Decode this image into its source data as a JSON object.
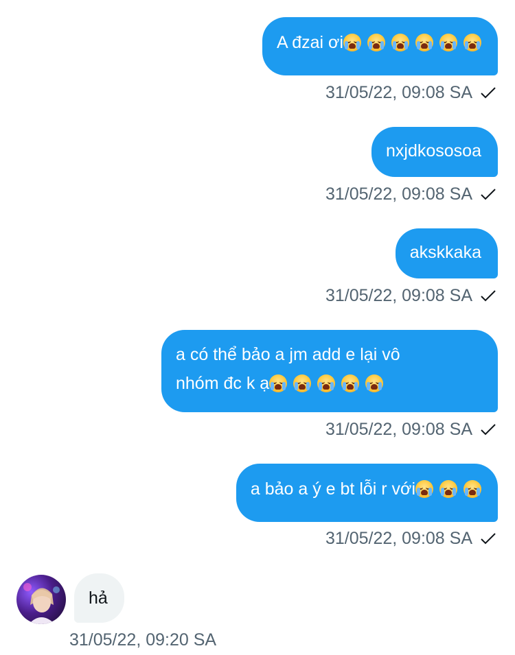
{
  "messages_out": [
    {
      "text": "A đzai ơi",
      "emoji_count": 6,
      "time": "31/05/22, 09:08 SA"
    },
    {
      "text": "nxjdkososoa",
      "emoji_count": 0,
      "time": "31/05/22, 09:08 SA"
    },
    {
      "text": "akskkaka",
      "emoji_count": 0,
      "time": "31/05/22, 09:08 SA"
    },
    {
      "line1": "a có thể bảo a jm add e lại vô",
      "line2": "nhóm đc k ạ",
      "emoji_count": 5,
      "time": "31/05/22, 09:08 SA"
    },
    {
      "text": "a bảo a ý e bt lỗi r với",
      "emoji_count": 3,
      "time": "31/05/22, 09:08 SA"
    }
  ],
  "message_in": {
    "text": "hả",
    "time": "31/05/22, 09:20 SA"
  },
  "emoji_name": "loudly-crying-face",
  "colors": {
    "outgoing_bubble": "#1d9bf0",
    "incoming_bubble": "#eff3f4",
    "meta_text": "#536471"
  }
}
